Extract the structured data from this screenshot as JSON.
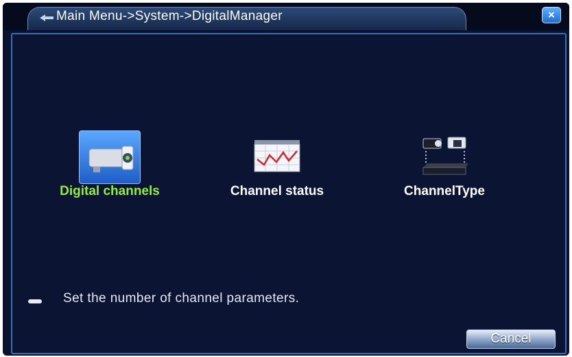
{
  "window": {
    "title": "Main Menu->System->DigitalManager",
    "close_label": "×"
  },
  "tiles": [
    {
      "label": "Digital channels",
      "icon": "camera-icon",
      "selected": true
    },
    {
      "label": "Channel status",
      "icon": "chart-icon",
      "selected": false
    },
    {
      "label": "ChannelType",
      "icon": "camera-dvr-icon",
      "selected": false
    }
  ],
  "hint": {
    "text": "Set the number of channel parameters."
  },
  "buttons": {
    "cancel_label": "Cancel"
  },
  "colors": {
    "background": "#0a1230",
    "active_label": "#93ee3c",
    "border": "#3b6fb3"
  }
}
